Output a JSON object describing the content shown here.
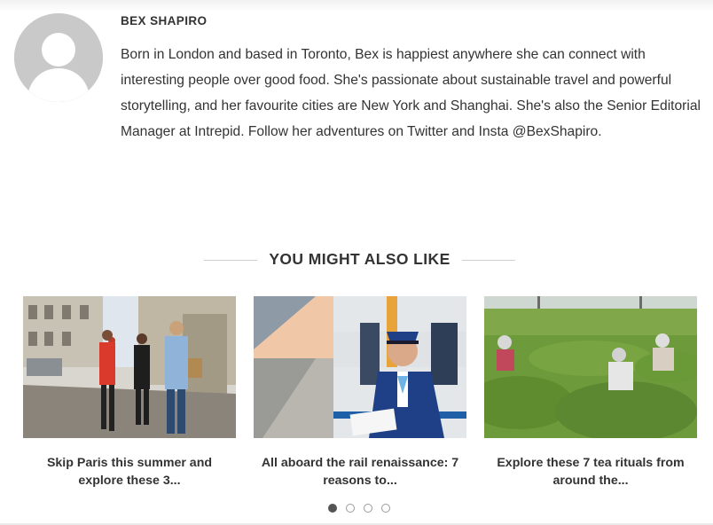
{
  "author": {
    "name": "BEX SHAPIRO",
    "bio": "Born in London and based in Toronto, Bex is happiest anywhere she can connect with interesting people over good food. She's passionate about sustainable travel and powerful storytelling, and her favourite cities are New York and Shanghai. She's also the Senior Editorial Manager at Intrepid. Follow her adventures on Twitter and Insta @BexShapiro."
  },
  "related": {
    "heading": "YOU MIGHT ALSO LIKE",
    "cards": [
      {
        "title": "Skip Paris this summer and explore these 3...",
        "image": "paris-street-walking-photo"
      },
      {
        "title": "All aboard the rail renaissance: 7 reasons to...",
        "image": "train-attendant-platform-photo"
      },
      {
        "title": "Explore these 7 tea rituals from around the...",
        "image": "tea-plantation-pickers-photo"
      }
    ],
    "pagination": {
      "total": 4,
      "active": 1
    }
  },
  "colors": {
    "text": "#333333",
    "avatar_bg": "#c9c9c9",
    "rule": "#cfcfcf",
    "dot_active": "#555555"
  }
}
